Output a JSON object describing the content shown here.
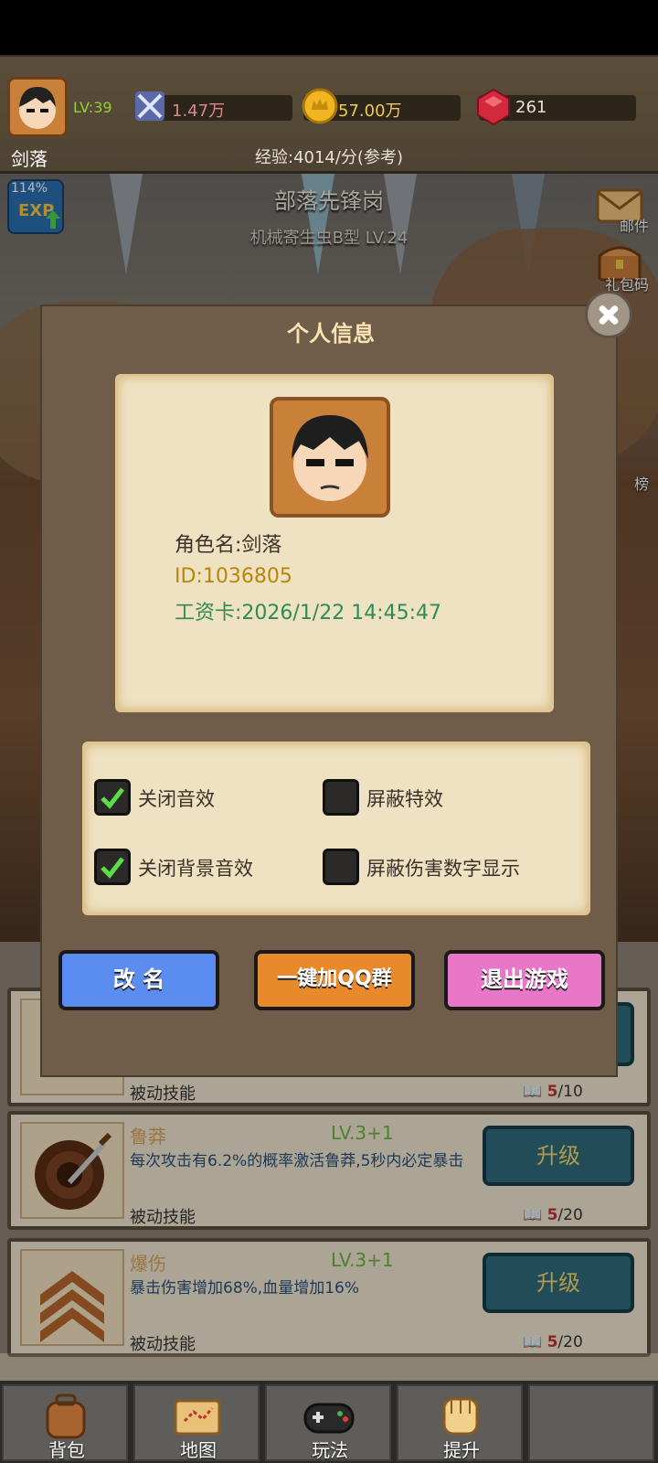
{
  "header": {
    "level": "LV:39",
    "player_name": "剑落",
    "power": "1.47万",
    "gold": "57.00万",
    "gems": "261",
    "exp_rate": "经验:4014/分(参考)"
  },
  "scene": {
    "stage_title": "部落先锋岗",
    "stage_subtitle": "机械寄生虫B型  LV.24",
    "exp_badge_pct": "114%",
    "exp_badge_label": "EXP",
    "side_mail": "邮件",
    "side_gift": "礼包码",
    "side_rank": "榜"
  },
  "dialog": {
    "title": "个人信息",
    "role_name": "角色名:剑落",
    "id": "ID:1036805",
    "salary_card": "工资卡:2026/1/22 14:45:47",
    "options": [
      {
        "label": "关闭音效",
        "checked": true
      },
      {
        "label": "屏蔽特效",
        "checked": false
      },
      {
        "label": "关闭背景音效",
        "checked": true
      },
      {
        "label": "屏蔽伤害数字显示",
        "checked": false
      }
    ],
    "rename_btn": "改 名",
    "qq_btn": "一键加QQ群",
    "exit_btn": "退出游戏"
  },
  "skills": [
    {
      "name": "",
      "lv": "",
      "desc": "",
      "type": "被动技能",
      "cost": "5",
      "cost_max": "/10"
    },
    {
      "name": "鲁莽",
      "lv": "LV.3+1",
      "desc": "每次攻击有6.2%的概率激活鲁莽,5秒内必定暴击",
      "type": "被动技能",
      "cost": "5",
      "cost_max": "/20",
      "btn": "升级"
    },
    {
      "name": "爆伤",
      "lv": "LV.3+1",
      "desc": "暴击伤害增加68%,血量增加16%",
      "type": "被动技能",
      "cost": "5",
      "cost_max": "/20",
      "btn": "升级"
    }
  ],
  "nav": {
    "bag": "背包",
    "map": "地图",
    "play": "玩法",
    "upgrade": "提升"
  },
  "colors": {
    "rename": "#5b8cf0",
    "qq": "#e88a2c",
    "exit": "#e877c8"
  }
}
